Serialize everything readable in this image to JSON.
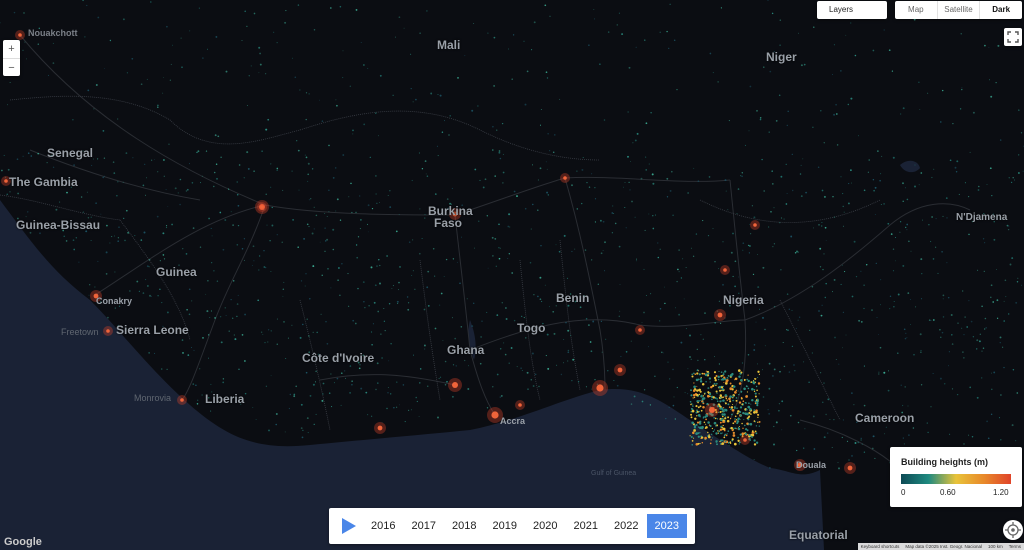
{
  "controls": {
    "layers_label": "Layers",
    "map_types": [
      "Map",
      "Satellite",
      "Dark"
    ],
    "zoom_in": "+",
    "zoom_out": "−"
  },
  "legend": {
    "title": "Building heights (m)",
    "ticks": [
      "0",
      "0.60",
      "1.20"
    ],
    "colors": [
      "#0d4a55",
      "#1f8a80",
      "#e8c33a",
      "#e88a2a",
      "#e0442a"
    ]
  },
  "timeline": {
    "years": [
      "2016",
      "2017",
      "2018",
      "2019",
      "2020",
      "2021",
      "2022",
      "2023"
    ],
    "selected": "2023"
  },
  "countries": [
    "Mali",
    "Niger",
    "Senegal",
    "The Gambia",
    "Guinea-Bissau",
    "Guinea",
    "Burkina Faso",
    "Benin",
    "Togo",
    "Nigeria",
    "Sierra Leone",
    "Côte d'Ivoire",
    "Ghana",
    "Liberia",
    "Cameroon",
    "N'Djamena",
    "Equatorial"
  ],
  "cities": [
    "Nouakchott",
    "Freetown",
    "Monrovia",
    "Accra",
    "Conakry",
    "Douala",
    "Gulf of Guinea"
  ],
  "attribution": {
    "google": "Google",
    "footer": [
      "Keyboard shortcuts",
      "Map data ©2025 Inst. Geogr. Nacional",
      "100 km",
      "Terms"
    ]
  },
  "colors": {
    "accent": "#4a86e8",
    "background": "#0b0d12",
    "sea": "#1a2235"
  }
}
